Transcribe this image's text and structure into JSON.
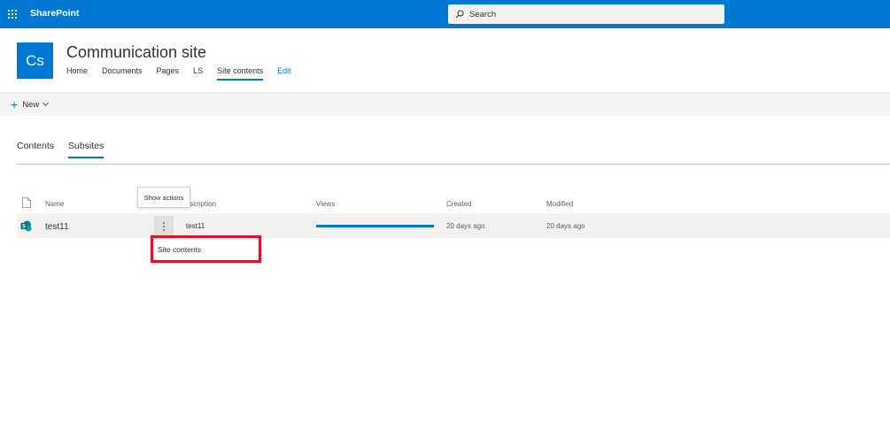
{
  "suite_bar": {
    "app_name": "SharePoint",
    "search_placeholder": "Search",
    "icons": [
      "app-launcher-icon",
      "search-icon"
    ]
  },
  "site": {
    "logo_text": "Cs",
    "title": "Communication site",
    "nav": [
      "Home",
      "Documents",
      "Pages",
      "LS",
      "Site contents",
      "Edit"
    ],
    "active_nav": "Site contents"
  },
  "command_bar": {
    "new_label": "New"
  },
  "tabs": {
    "items": [
      "Contents",
      "Subsites"
    ],
    "active": "Subsites"
  },
  "list": {
    "columns": {
      "name": "Name",
      "description": "Description",
      "views": "Views",
      "created": "Created",
      "modified": "Modified"
    },
    "rows": [
      {
        "name": "test11",
        "description": "test11",
        "views_fraction": 1.0,
        "created": "20 days ago",
        "modified": "20 days ago"
      }
    ]
  },
  "tooltip": {
    "text": "Show actions"
  },
  "context_menu": {
    "items": [
      "Site contents"
    ]
  },
  "colors": {
    "brand": "#0078d4",
    "highlight": "#e81123"
  }
}
